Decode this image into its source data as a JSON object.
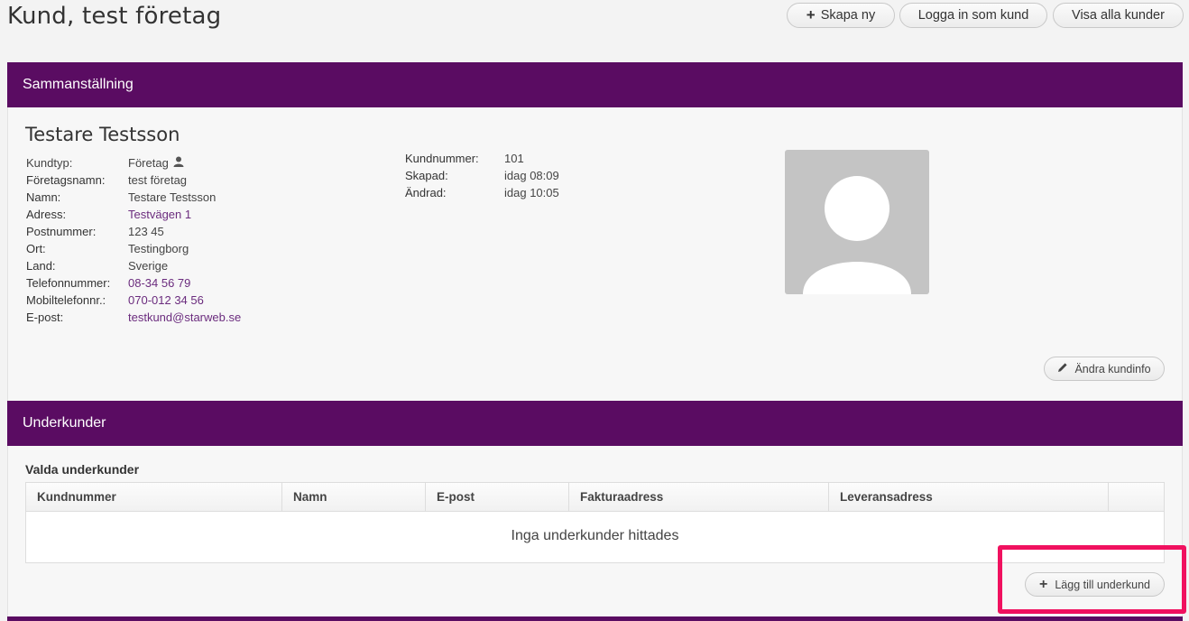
{
  "page": {
    "title": "Kund, test företag"
  },
  "toolbar": {
    "create_new": "Skapa ny",
    "login_as_customer": "Logga in som kund",
    "show_all_customers": "Visa alla kunder"
  },
  "summary": {
    "heading": "Sammanställning",
    "customer_name": "Testare Testsson",
    "fields": [
      {
        "label": "Kundtyp:",
        "value": "Företag"
      },
      {
        "label": "Företagsnamn:",
        "value": "test företag"
      },
      {
        "label": "Namn:",
        "value": "Testare Testsson"
      },
      {
        "label": "Adress:",
        "value": "Testvägen 1"
      },
      {
        "label": "Postnummer:",
        "value": "123 45"
      },
      {
        "label": "Ort:",
        "value": "Testingborg"
      },
      {
        "label": "Land:",
        "value": "Sverige"
      },
      {
        "label": "Telefonnummer:",
        "value": "08-34 56 79"
      },
      {
        "label": "Mobiltelefonnr.:",
        "value": "070-012 34 56"
      },
      {
        "label": "E-post:",
        "value": "testkund@starweb.se"
      }
    ],
    "meta": [
      {
        "label": "Kundnummer:",
        "value": "101"
      },
      {
        "label": "Skapad:",
        "value": "idag 08:09"
      },
      {
        "label": "Ändrad:",
        "value": "idag 10:05"
      }
    ],
    "edit_button": "Ändra kundinfo"
  },
  "subcustomers": {
    "heading": "Underkunder",
    "subtitle": "Valda underkunder",
    "columns": [
      "Kundnummer",
      "Namn",
      "E-post",
      "Fakturaadress",
      "Leveransadress"
    ],
    "empty_message": "Inga underkunder hittades",
    "add_button": "Lägg till underkund"
  },
  "colors": {
    "header_purple": "#5a0c62",
    "link_purple": "#6b2c7e",
    "highlight": "#f0115f"
  }
}
